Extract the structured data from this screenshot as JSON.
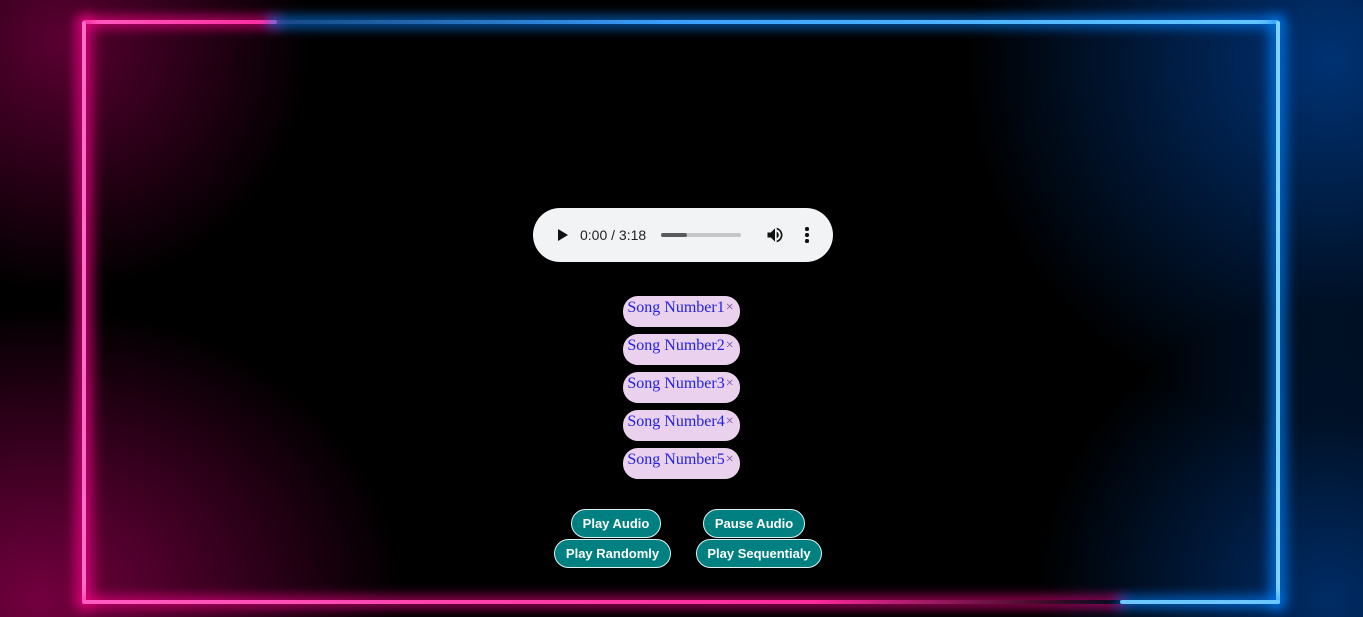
{
  "player": {
    "time": "0:00 / 3:18",
    "progress_fraction": 0.32,
    "colors": {
      "background": "#f1f3f4",
      "progress_fill": "#5a5a5a",
      "progress_track": "#c4c6c8"
    },
    "icons": {
      "play": "play-icon",
      "volume": "volume-icon",
      "menu": "more-vert-icon"
    }
  },
  "songs": [
    {
      "label": "Song Number1",
      "remove": "×"
    },
    {
      "label": "Song Number2",
      "remove": "×"
    },
    {
      "label": "Song Number3",
      "remove": "×"
    },
    {
      "label": "Song Number4",
      "remove": "×"
    },
    {
      "label": "Song Number5",
      "remove": "×"
    }
  ],
  "controls": {
    "play_label": "Play Audio",
    "pause_label": "Pause Audio",
    "random_label": "Play Randomly",
    "sequential_label": "Play Sequentialy"
  },
  "theme": {
    "neon_pink": "#ff3fae",
    "neon_blue": "#3aa0ff",
    "button_bg": "#008080",
    "song_bg": "#ead1ee",
    "song_text": "#2222e0"
  }
}
